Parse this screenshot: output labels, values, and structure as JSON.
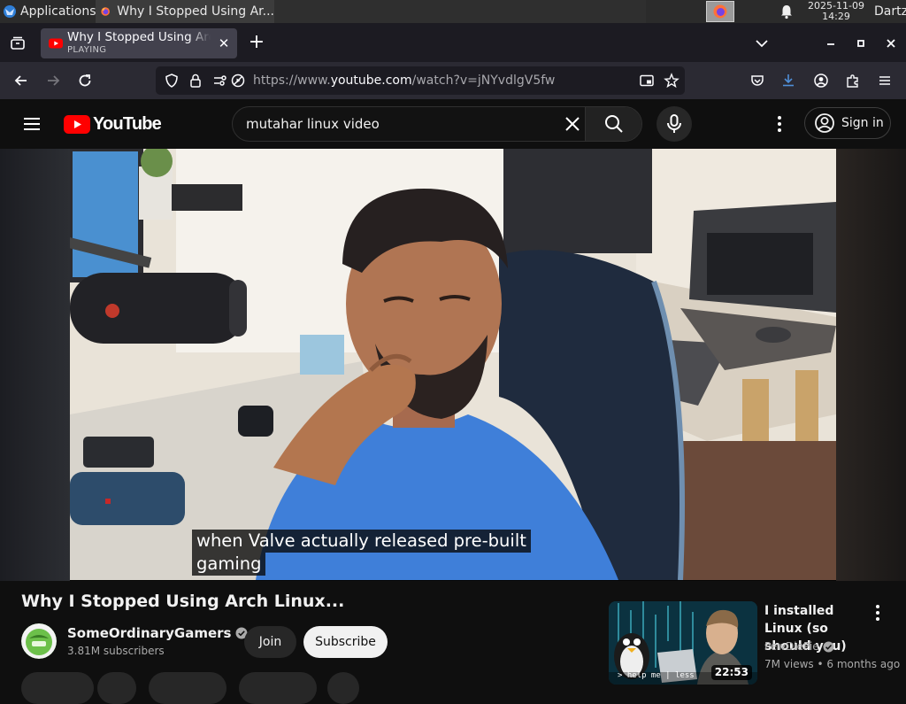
{
  "taskbar": {
    "apps_label": "Applications",
    "task_title": "Why I Stopped Using Ar...",
    "clock_date": "2025-11-09",
    "clock_time": "14:29",
    "user": "Dartz"
  },
  "browser": {
    "tab_title": "Why I Stopped Using Arch Linux...",
    "tab_status": "PLAYING",
    "url_prefix": "https://www.",
    "url_domain": "youtube.com",
    "url_suffix": "/watch?v=jNYvdlgV5fw"
  },
  "youtube": {
    "logo_text": "YouTube",
    "search_query": "mutahar linux video",
    "signin_label": "Sign in"
  },
  "video": {
    "caption_line1": "when Valve actually released pre-built",
    "caption_line2": "gaming"
  },
  "watch": {
    "title": "Why I Stopped Using Arch Linux...",
    "channel_name": "SomeOrdinaryGamers",
    "subscribers": "3.81M subscribers",
    "join_label": "Join",
    "subscribe_label": "Subscribe"
  },
  "recommendation": {
    "title": "I installed Linux (so should you)",
    "channel": "PewDiePie",
    "meta": "7M views • 6 months ago",
    "duration": "22:53",
    "thumb_text": "> help me | less"
  },
  "colors": {
    "yt_red": "#ff0000",
    "browser_bg": "#1c1b22",
    "toolbar_bg": "#2b2a33",
    "page_bg": "#0f0f0f"
  }
}
